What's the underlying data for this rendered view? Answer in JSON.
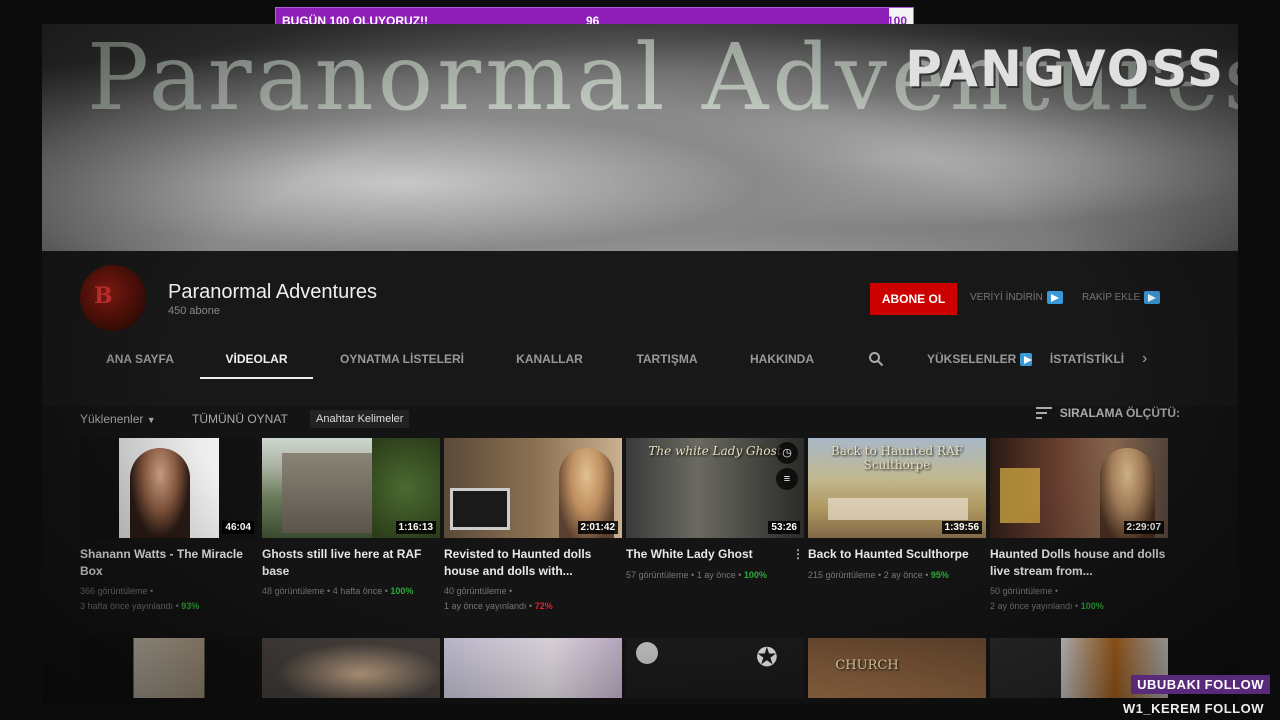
{
  "goal": {
    "text": "BUGÜN 100 OLUYORUZ!!",
    "current": "96",
    "target": "100",
    "progress": 0.96
  },
  "watermark": "PANGVOSS",
  "banner": {
    "title": "Paranormal Adventures"
  },
  "channel": {
    "name": "Paranormal Adventures",
    "subscribers": "450 abone",
    "subscribe_label": "ABONE OL",
    "download_label": "VERİYİ İNDİRİN",
    "compare_label": "RAKİP EKLE"
  },
  "tabs": {
    "home": "ANA SAYFA",
    "videos": "VİDEOLAR",
    "playlists": "OYNATMA LİSTELERİ",
    "channels": "KANALLAR",
    "discussion": "TARTIŞMA",
    "about": "HAKKINDA",
    "rising": "YÜKSELENLER",
    "stats": "İSTATİSTİKLİ"
  },
  "filters": {
    "uploaded": "Yüklenenler",
    "play_all": "TÜMÜNÜ OYNAT",
    "keywords": "Anahtar Kelimeler",
    "sort": "SIRALAMA ÖLÇÜTÜ:"
  },
  "videos": [
    {
      "title": "Shanann Watts - The Miracle Box",
      "duration": "46:04",
      "views": "366 görüntüleme •",
      "age": "3 hafta önce yayınlandı •",
      "pct": "93%"
    },
    {
      "title": "Ghosts still live here at RAF base",
      "duration": "1:16:13",
      "views": "48 görüntüleme • 4 hafta önce •",
      "age": "",
      "pct": "100%"
    },
    {
      "title": "Revisted to Haunted dolls house and dolls with...",
      "duration": "2:01:42",
      "views": "40 görüntüleme •",
      "age": "1 ay önce yayınlandı •",
      "pct": "72%"
    },
    {
      "title": "The White Lady Ghost",
      "duration": "53:26",
      "views": "57 görüntüleme • 1 ay önce •",
      "age": "",
      "pct": "100%",
      "overlay": "The white Lady Ghost"
    },
    {
      "title": "Back to Haunted Sculthorpe",
      "duration": "1:39:56",
      "views": "215 görüntüleme • 2 ay önce •",
      "age": "",
      "pct": "95%",
      "overlay": "Back to Haunted RAF Sculthorpe"
    },
    {
      "title": "Haunted Dolls house and dolls live stream from...",
      "duration": "2:29:07",
      "views": "50 görüntüleme •",
      "age": "2 ay önce yayınlandı •",
      "pct": "100%"
    }
  ],
  "row2_overlay": "CHURCH",
  "follows": [
    "UBUBAKI  FOLLOW",
    "W1_KEREM  FOLLOW"
  ]
}
